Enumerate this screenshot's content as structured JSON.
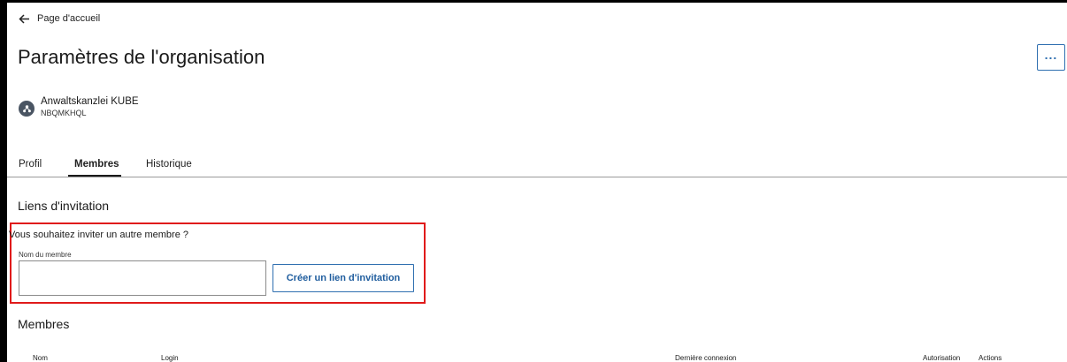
{
  "nav": {
    "back_label": "Page d'accueil"
  },
  "header": {
    "title": "Paramètres de l'organisation",
    "more_label": "..."
  },
  "organization": {
    "name": "Anwaltskanzlei KUBE",
    "code": "NBQMKHQL"
  },
  "tabs": [
    {
      "label": "Profil",
      "active": false
    },
    {
      "label": "Membres",
      "active": true
    },
    {
      "label": "Historique",
      "active": false
    }
  ],
  "invitation": {
    "title": "Liens d'invitation",
    "question": "Vous souhaitez inviter un autre membre ?",
    "field_label": "Nom du membre",
    "field_value": "",
    "button_label": "Créer un lien d'invitation"
  },
  "members": {
    "title": "Membres",
    "columns": [
      "Nom",
      "Login",
      "Dernière connexion",
      "Autorisation",
      "Actions"
    ]
  },
  "colors": {
    "accent": "#2f6fb0",
    "highlight": "#e01a1a"
  }
}
